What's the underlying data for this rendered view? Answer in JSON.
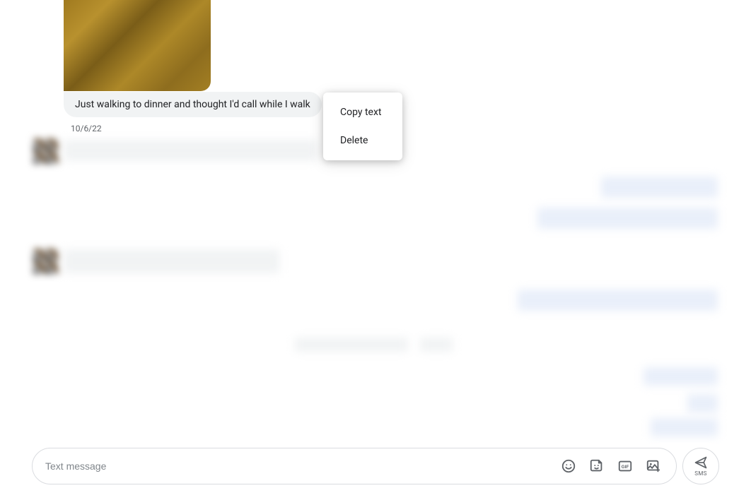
{
  "attachment": {
    "alt": "Photo attachment (ground texture)"
  },
  "message": {
    "text": "Just walking to dinner and thought I'd call while I walk",
    "date": "10/6/22"
  },
  "context_menu": {
    "copy": "Copy text",
    "delete": "Delete"
  },
  "compose": {
    "placeholder": "Text message",
    "send_label": "SMS"
  },
  "icons": {
    "emoji": "emoji-icon",
    "sticker": "sticker-icon",
    "gif": "gif-icon",
    "image": "image-icon",
    "send": "send-icon"
  }
}
